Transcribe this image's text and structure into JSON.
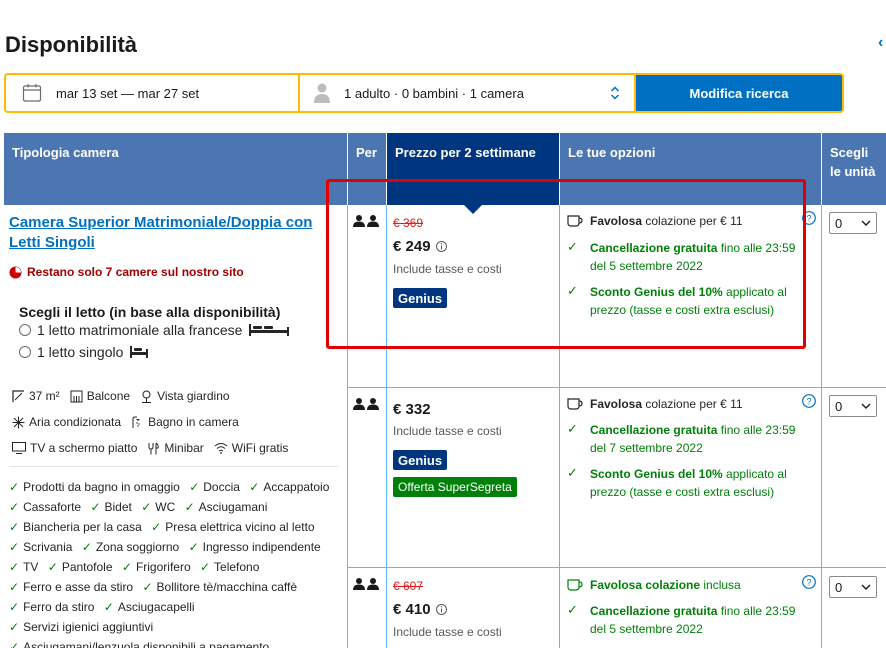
{
  "page": {
    "title": "Disponibilità"
  },
  "search": {
    "dates": "mar 13 set — mar 27 set",
    "occupancy": "1 adulto · 0 bambini · 1 camera",
    "button": "Modifica ricerca"
  },
  "table": {
    "headers": {
      "room_type": "Tipologia camera",
      "per": "Per",
      "price": "Prezzo per 2 settimane",
      "options": "Le tue opzioni",
      "select_units": "Scegli le unità"
    }
  },
  "room": {
    "name": "Camera Superior Matrimoniale/Doppia con Letti Singoli",
    "scarcity": "Restano solo 7 camere sul nostro sito",
    "bed_title": "Scegli il letto (in base alla disponibilità)",
    "bed_options": [
      "1 letto matrimoniale alla francese",
      "1 letto singolo"
    ],
    "facilities": [
      [
        {
          "icon": "room-size-icon",
          "label": "37 m²"
        },
        {
          "icon": "balcony-icon",
          "label": "Balcone"
        },
        {
          "icon": "garden-view-icon",
          "label": "Vista giardino"
        }
      ],
      [
        {
          "icon": "air-conditioning-icon",
          "label": "Aria condizionata"
        },
        {
          "icon": "bathroom-icon",
          "label": "Bagno in camera"
        }
      ],
      [
        {
          "icon": "tv-icon",
          "label": "TV a schermo piatto"
        },
        {
          "icon": "minibar-icon",
          "label": "Minibar"
        },
        {
          "icon": "wifi-icon",
          "label": "WiFi gratis"
        }
      ]
    ],
    "amenities": [
      [
        "Prodotti da bagno in omaggio",
        "Doccia",
        "Accappatoio"
      ],
      [
        "Cassaforte",
        "Bidet",
        "WC",
        "Asciugamani"
      ],
      [
        "Biancheria per la casa",
        "Presa elettrica vicino al letto"
      ],
      [
        "Scrivania",
        "Zona soggiorno",
        "Ingresso indipendente"
      ],
      [
        "TV",
        "Pantofole",
        "Frigorifero",
        "Telefono"
      ],
      [
        "Ferro e asse da stiro",
        "Bollitore tè/macchina caffè"
      ],
      [
        "Ferro da stiro",
        "Asciugacapelli"
      ],
      [
        "Servizi igienici aggiuntivi"
      ],
      [
        "Asciugamani/lenzuola disponibili a pagamento"
      ]
    ]
  },
  "offers": [
    {
      "original_price": "€ 369",
      "price": "€ 249",
      "taxes": "Include tasse e costi",
      "badges": {
        "genius": "Genius"
      },
      "breakfast": {
        "bold": "Favolosa",
        "rest": " colazione per € 11"
      },
      "cancellation": {
        "bold": "Cancellazione gratuita",
        "rest": " fino alle 23:59",
        "line2": "del 5 settembre 2022"
      },
      "genius_discount": {
        "bold": "Sconto Genius del 10%",
        "rest": " applicato al",
        "line2": "prezzo (tasse e costi extra esclusi)"
      },
      "selected_units": "0"
    },
    {
      "original_price": "",
      "price": "€ 332",
      "taxes": "Include tasse e costi",
      "badges": {
        "genius": "Genius",
        "secret": "Offerta SuperSegreta"
      },
      "breakfast": {
        "bold": "Favolosa",
        "rest": " colazione per € 11"
      },
      "cancellation": {
        "bold": "Cancellazione gratuita",
        "rest": " fino alle 23:59",
        "line2": "del 7 settembre 2022"
      },
      "genius_discount": {
        "bold": "Sconto Genius del 10%",
        "rest": " applicato al",
        "line2": "prezzo (tasse e costi extra esclusi)"
      },
      "selected_units": "0"
    },
    {
      "original_price": "€ 607",
      "price": "€ 410",
      "taxes": "Include tasse e costi",
      "badges": {},
      "breakfast": {
        "bold": "Favolosa colazione",
        "rest": " inclusa"
      },
      "cancellation": {
        "bold": "Cancellazione gratuita",
        "rest": " fino alle 23:59",
        "line2": "del 5 settembre 2022"
      },
      "selected_units": "0"
    }
  ],
  "colors": {
    "header": "#4c76b2",
    "header_active": "#003580",
    "brand_blue": "#0071c2",
    "accent_yellow": "#febb02",
    "success_green": "#008009",
    "highlight_red": "#e00000"
  }
}
